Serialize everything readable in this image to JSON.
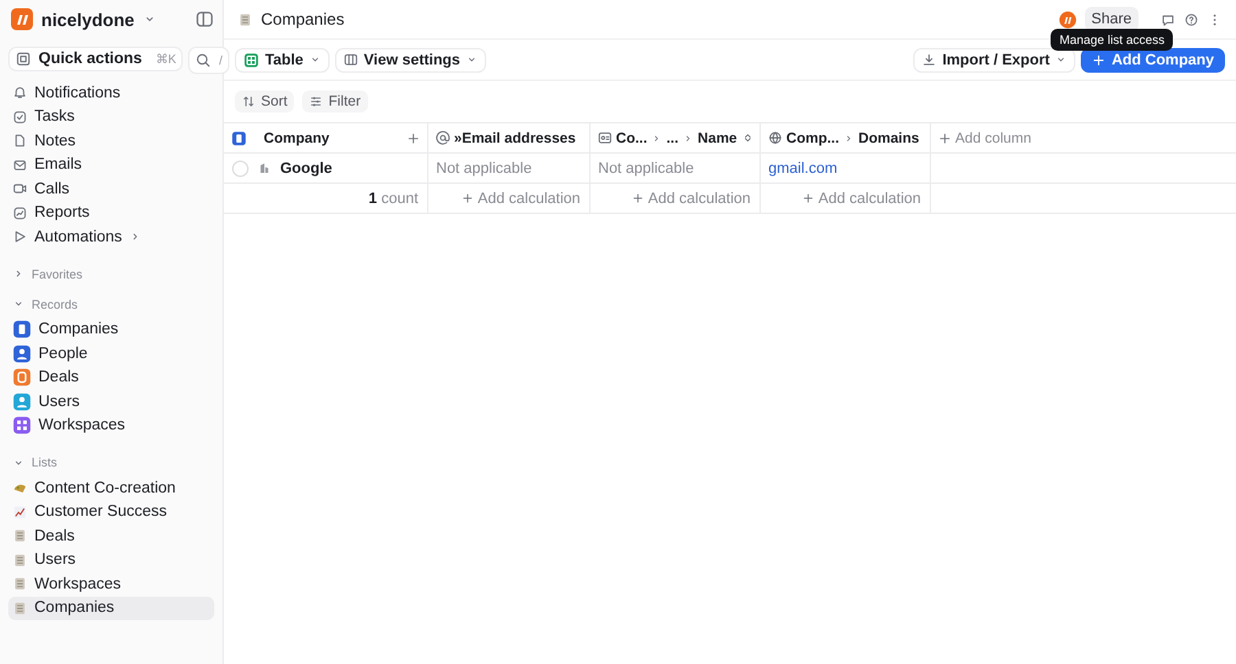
{
  "workspace": {
    "name": "nicelydone"
  },
  "quick_actions": {
    "label": "Quick actions",
    "shortcut": "⌘K",
    "search_shortcut": "/"
  },
  "nav": [
    {
      "label": "Notifications",
      "has_submenu": false
    },
    {
      "label": "Tasks",
      "has_submenu": false
    },
    {
      "label": "Notes",
      "has_submenu": false
    },
    {
      "label": "Emails",
      "has_submenu": false
    },
    {
      "label": "Calls",
      "has_submenu": false
    },
    {
      "label": "Reports",
      "has_submenu": false
    },
    {
      "label": "Automations",
      "has_submenu": true
    }
  ],
  "sections": [
    {
      "title": "Favorites",
      "expanded": false
    },
    {
      "title": "Records",
      "expanded": true,
      "items": [
        {
          "label": "Companies",
          "color": "#2f64d8",
          "selected": false
        },
        {
          "label": "People",
          "color": "#2f64d8",
          "selected": false
        },
        {
          "label": "Deals",
          "color": "#ef7b30",
          "selected": false
        },
        {
          "label": "Users",
          "color": "#22a7d6",
          "selected": false
        },
        {
          "label": "Workspaces",
          "color": "#8a5cf0",
          "selected": false
        }
      ]
    },
    {
      "title": "Lists",
      "expanded": true,
      "items": [
        {
          "label": "Content Co-creation",
          "selected": false
        },
        {
          "label": "Customer Success",
          "selected": false
        },
        {
          "label": "Deals",
          "selected": false
        },
        {
          "label": "Users",
          "selected": false
        },
        {
          "label": "Workspaces",
          "selected": false
        },
        {
          "label": "Companies",
          "selected": true
        }
      ]
    }
  ],
  "header": {
    "title": "Companies",
    "share": "Share",
    "tooltip": "Manage list access"
  },
  "toolbar": {
    "view": "Table",
    "view_settings": "View settings",
    "import_export": "Import / Export",
    "add": "Add Company"
  },
  "filters": [
    "Sort",
    "Filter"
  ],
  "table": {
    "columns": [
      {
        "path": [
          "Company"
        ]
      },
      {
        "path": [
          "»Email addresses"
        ]
      },
      {
        "path": [
          "Co...",
          "...",
          "Name"
        ]
      },
      {
        "path": [
          "Comp...",
          "Domains"
        ]
      }
    ],
    "add_column": "Add column",
    "rows": [
      {
        "checked": false,
        "cells": [
          {
            "text": "Google",
            "kind": "record"
          },
          {
            "text": "Not applicable",
            "kind": "muted"
          },
          {
            "text": "Not applicable",
            "kind": "muted"
          },
          {
            "text": "gmail.com",
            "kind": "link"
          }
        ]
      }
    ],
    "footer": [
      "1 count",
      "Add calculation",
      "Add calculation",
      "Add calculation"
    ]
  }
}
